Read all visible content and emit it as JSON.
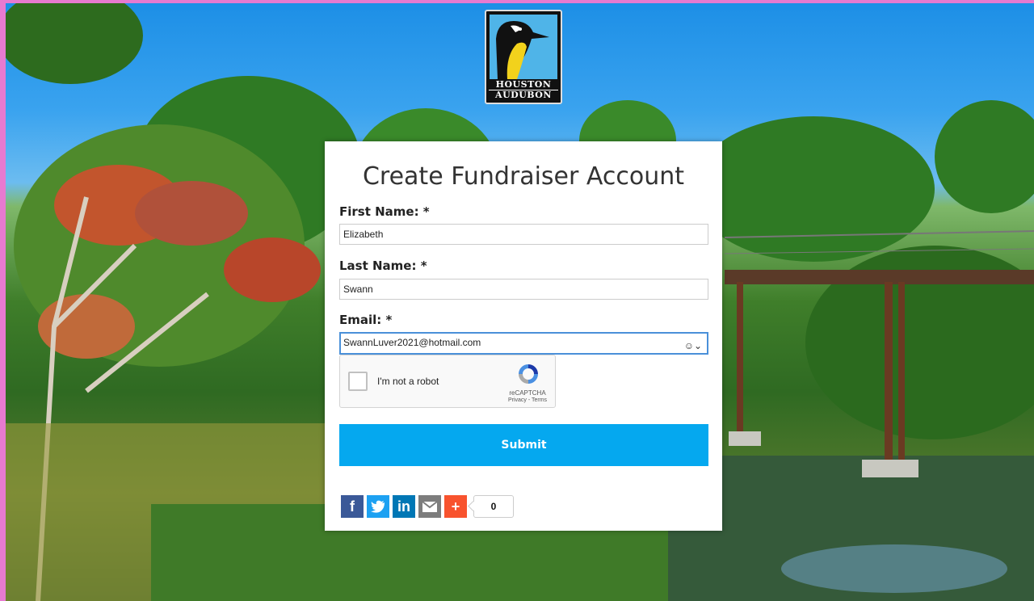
{
  "logo": {
    "line1": "HOUSTON",
    "line2": "AUDUBON"
  },
  "form": {
    "title": "Create Fundraiser Account",
    "first_name_label": "First Name: *",
    "first_name_value": "Elizabeth",
    "last_name_label": "Last Name: *",
    "last_name_value": "Swann",
    "email_label": "Email: *",
    "email_value": "SwannLuver2021@hotmail.com",
    "autofill_icon": "contact-autofill-icon",
    "captcha_label": "I'm not a robot",
    "captcha_brand": "reCAPTCHA",
    "captcha_terms": "Privacy - Terms",
    "submit_label": "Submit"
  },
  "share": {
    "facebook": "f",
    "twitter": "twitter-bird-icon",
    "linkedin": "in",
    "email": "envelope-icon",
    "more": "+",
    "count": "0",
    "colors": {
      "facebook": "#3b5998",
      "twitter": "#1da1f2",
      "linkedin": "#0077b5",
      "email": "#7d7d7d",
      "more": "#f8532e"
    }
  }
}
